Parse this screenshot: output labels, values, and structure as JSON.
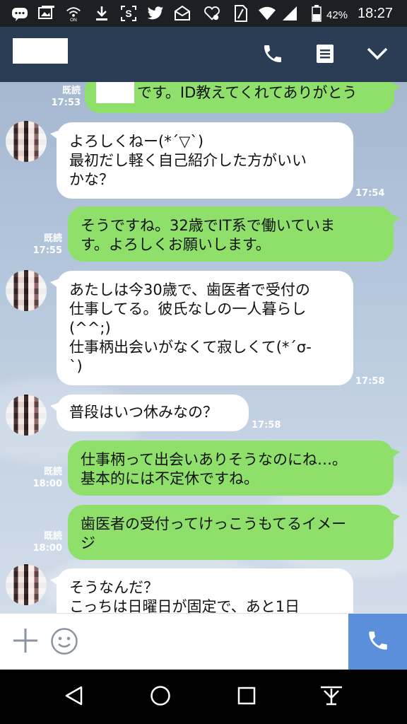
{
  "status_bar": {
    "battery_percent": "42%",
    "time": "18:27",
    "on_label": "ON"
  },
  "header": {
    "contact_name": ""
  },
  "messages": [
    {
      "sender": "me",
      "lines": [
        "です。ID教えてくれてありがとう"
      ],
      "read_label": "既読",
      "time": "17:53"
    },
    {
      "sender": "them",
      "lines": [
        "よろしくねー(*´▽`)",
        "最初だし軽く自己紹介した方がいい",
        "かな？"
      ],
      "time": "17:54"
    },
    {
      "sender": "me",
      "lines": [
        "そうですね。32歳でIT系で働いていま",
        "す。よろしくお願いします。"
      ],
      "read_label": "既読",
      "time": "17:55"
    },
    {
      "sender": "them",
      "lines": [
        "あたしは今30歳で、歯医者で受付の",
        "仕事してる。彼氏なしの一人暮らし",
        "(^^;)",
        "仕事柄出会いがなくて寂しくて(*´σ-",
        "`)"
      ],
      "time": "17:58"
    },
    {
      "sender": "them",
      "lines": [
        "普段はいつ休みなの？"
      ],
      "time": "17:58"
    },
    {
      "sender": "me",
      "lines": [
        "仕事柄って出会いありそうなのにね…。",
        "基本的には不定休ですね。"
      ],
      "read_label": "既読",
      "time": "18:00"
    },
    {
      "sender": "me",
      "lines": [
        "歯医者の受付ってけっこうもてるイメー",
        "ジ"
      ],
      "read_label": "既読",
      "time": "18:00"
    },
    {
      "sender": "them",
      "lines": [
        "そうなんだ？",
        "こっちは日曜日が固定で、あと1日"
      ],
      "time": ""
    }
  ],
  "icons": {
    "statusbar": [
      "line-notification-icon",
      "gallery-icon",
      "wifi-calling-icon",
      "download-icon",
      "screenshot-icon",
      "twitter-icon",
      "mail-icon",
      "heart-app-icon",
      "sim-icon",
      "wifi-icon",
      "signal-icon",
      "battery-icon"
    ],
    "header": [
      "phone-icon",
      "menu-icon",
      "chevron-down-icon"
    ],
    "input": [
      "plus-icon",
      "emoji-icon",
      "call-icon"
    ],
    "nav": [
      "back-icon",
      "home-icon",
      "recents-icon",
      "notification-pull-icon"
    ]
  },
  "colors": {
    "header": "#2b3d55",
    "my_bubble": "#8ee06a",
    "their_bubble": "#ffffff",
    "call_button": "#5b8fdb"
  }
}
